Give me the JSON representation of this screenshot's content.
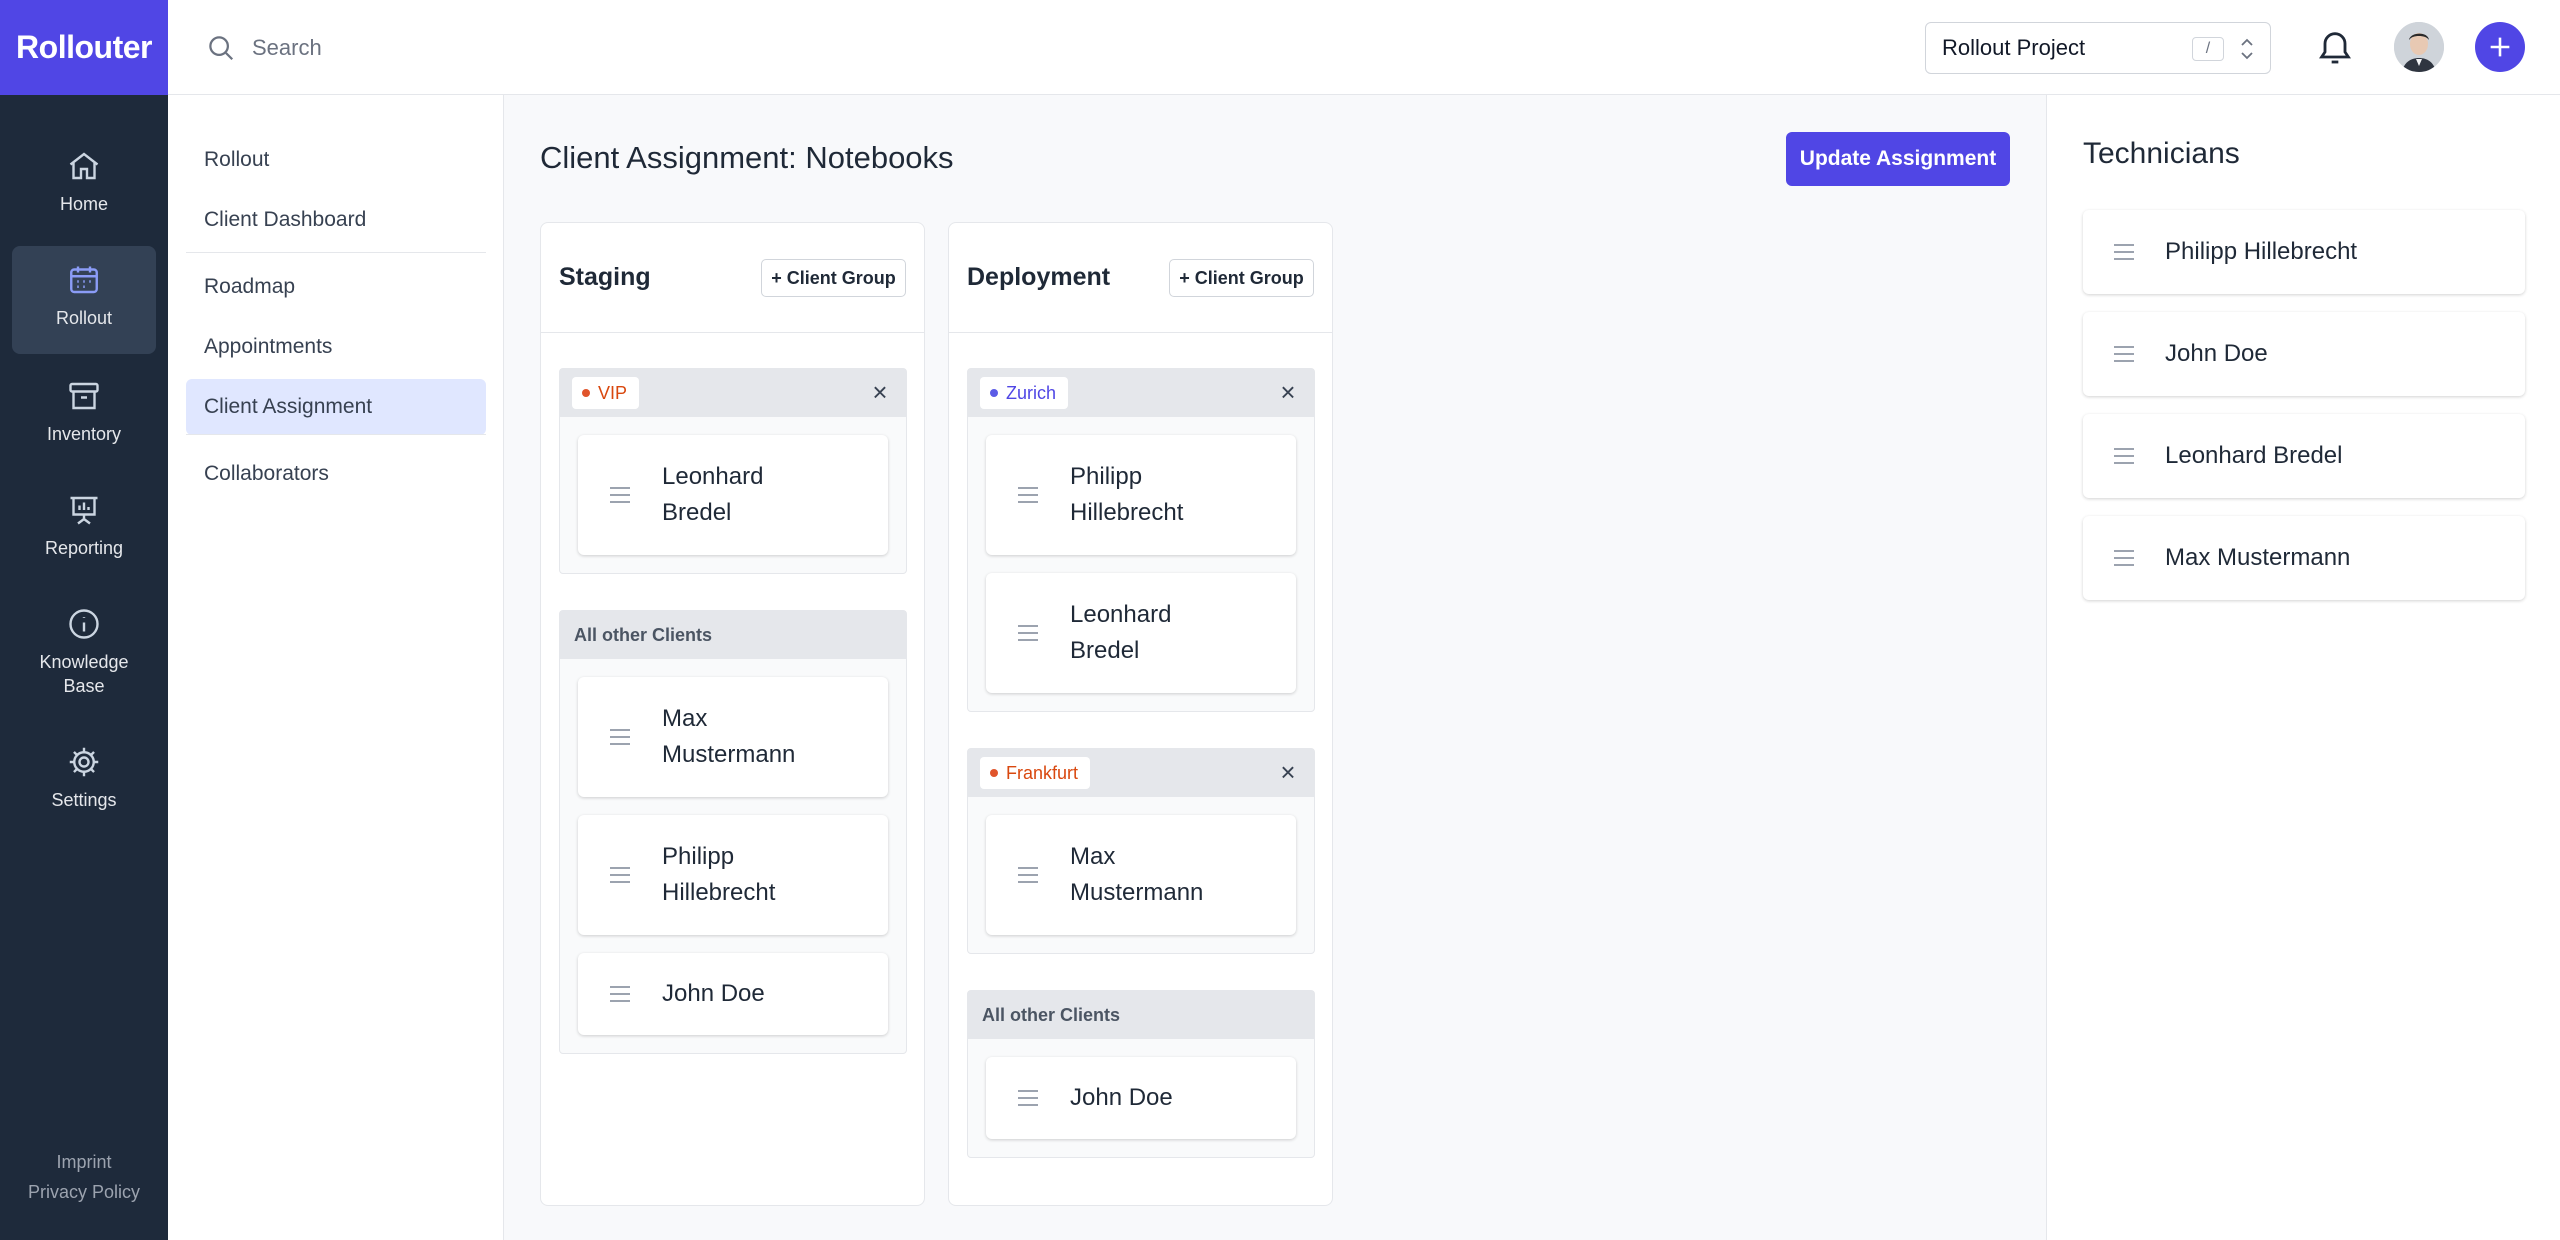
{
  "brand": {
    "logo_text": "Rollouter",
    "accent": "#5046e5"
  },
  "rail": {
    "items": [
      {
        "label": "Home",
        "icon": "home-icon"
      },
      {
        "label": "Rollout",
        "icon": "calendar-icon",
        "active": true
      },
      {
        "label": "Inventory",
        "icon": "archive-icon"
      },
      {
        "label": "Reporting",
        "icon": "presentation-chart-icon"
      },
      {
        "label": "Knowledge Base",
        "icon": "info-icon"
      },
      {
        "label": "Settings",
        "icon": "gear-icon"
      }
    ],
    "footer": {
      "imprint": "Imprint",
      "privacy": "Privacy Policy"
    }
  },
  "topbar": {
    "search_placeholder": "Search",
    "project_select": {
      "value": "Rollout Project",
      "shortcut": "/"
    }
  },
  "subnav": {
    "items": [
      {
        "label": "Rollout"
      },
      {
        "label": "Client Dashboard"
      },
      {
        "label": "Roadmap"
      },
      {
        "label": "Appointments"
      },
      {
        "label": "Client Assignment",
        "active": true
      },
      {
        "label": "Collaborators"
      }
    ]
  },
  "main": {
    "title": "Client Assignment: Notebooks",
    "update_button": "Update Assignment",
    "columns": [
      {
        "title": "Staging",
        "add_group_label": "+ Client Group",
        "groups": [
          {
            "tag": "VIP",
            "tag_color": "#e0542b",
            "tag_text_color": "#d9480f",
            "cards": [
              "Leonhard Bredel"
            ]
          },
          {
            "label": "All other Clients",
            "cards": [
              "Max Mustermann",
              "Philipp Hillebrecht",
              "John Doe"
            ]
          }
        ]
      },
      {
        "title": "Deployment",
        "add_group_label": "+ Client Group",
        "groups": [
          {
            "tag": "Zurich",
            "tag_color": "#5b5be6",
            "tag_text_color": "#4f46e5",
            "cards": [
              "Philipp Hillebrecht",
              "Leonhard Bredel"
            ]
          },
          {
            "tag": "Frankfurt",
            "tag_color": "#e0542b",
            "tag_text_color": "#d9480f",
            "cards": [
              "Max Mustermann"
            ]
          },
          {
            "label": "All other Clients",
            "cards": [
              "John Doe"
            ]
          }
        ]
      }
    ]
  },
  "technicians": {
    "title": "Technicians",
    "items": [
      "Philipp Hillebrecht",
      "John Doe",
      "Leonhard Bredel",
      "Max Mustermann"
    ]
  }
}
